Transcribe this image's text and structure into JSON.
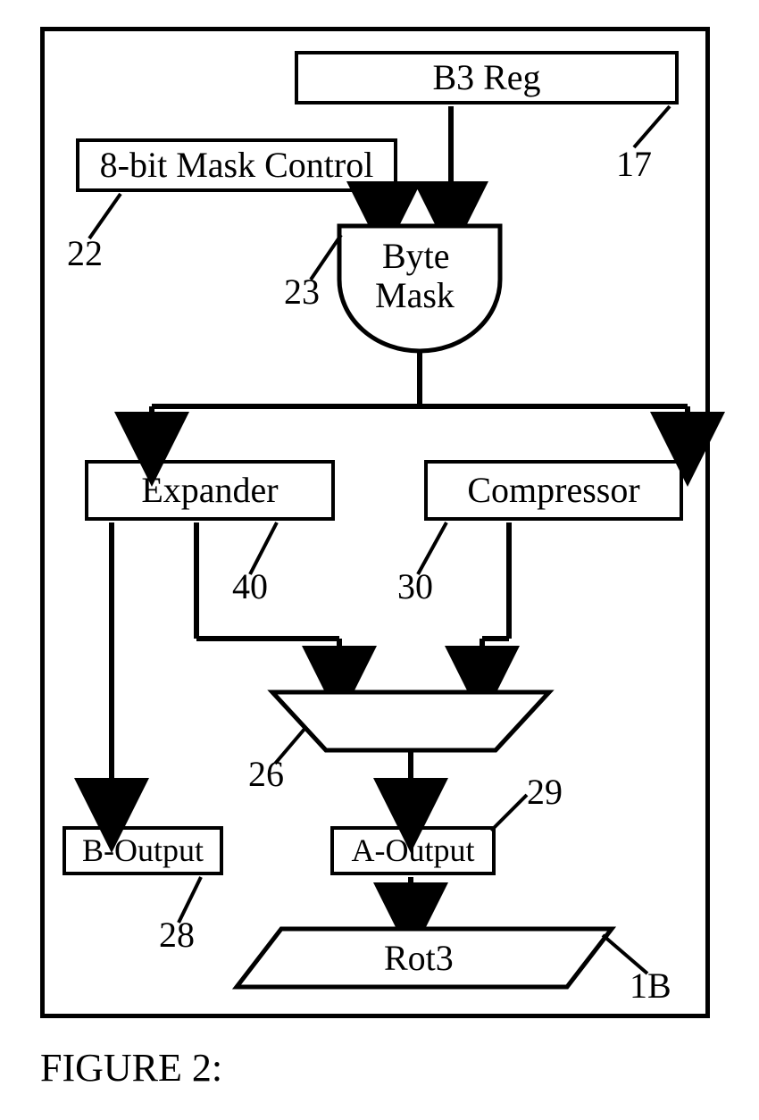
{
  "caption": "FIGURE 2:",
  "blocks": {
    "b3_reg": "B3 Reg",
    "mask_ctrl": "8-bit Mask Control",
    "byte_mask_line1": "Byte",
    "byte_mask_line2": "Mask",
    "expander": "Expander",
    "compressor": "Compressor",
    "mux_ref": "26",
    "b_output": "B-Output",
    "a_output": "A-Output",
    "rot3": "Rot3"
  },
  "refs": {
    "b3_reg": "17",
    "mask_ctrl": "22",
    "byte_mask": "23",
    "expander": "40",
    "compressor": "30",
    "b_output": "28",
    "a_output": "29",
    "rot3": "1B"
  }
}
